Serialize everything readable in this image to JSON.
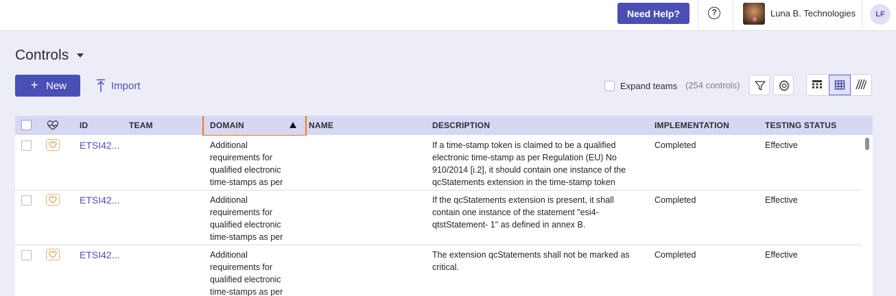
{
  "topbar": {
    "help_label": "Need Help?",
    "help_icon": "question-circle-icon",
    "org_name": "Luna B. Technologies",
    "user_initials": "LF"
  },
  "page": {
    "title": "Controls"
  },
  "actions": {
    "new_label": "New",
    "import_label": "Import",
    "expand_teams_label": "Expand teams",
    "expand_teams_checked": false,
    "count_label": "(254 controls)"
  },
  "table": {
    "headers": {
      "id": "ID",
      "team": "TEAM",
      "domain": "DOMAIN",
      "name": "NAME",
      "description": "DESCRIPTION",
      "implementation": "IMPLEMENTATION",
      "testing_status": "TESTING STATUS"
    },
    "sort": {
      "column": "DOMAIN",
      "direction": "ascending"
    },
    "rows": [
      {
        "id": "ETSI42...",
        "team": "",
        "domain": "Additional requirements for qualified electronic time-stamps as per",
        "name": "",
        "description": "If a time-stamp token is claimed to be a qualified electronic time-stamp as per Regulation (EU) No 910/2014 [i.2], it should contain one instance of the qcStatements extension in the time-stamp token",
        "implementation": "Completed",
        "testing_status": "Effective"
      },
      {
        "id": "ETSI42...",
        "team": "",
        "domain": "Additional requirements for qualified electronic time-stamps as per",
        "name": "",
        "description": "If the qcStatements extension is present, it shall contain one instance of the statement \"esi4-qtstStatement- 1\" as defined in annex B.",
        "implementation": "Completed",
        "testing_status": "Effective"
      },
      {
        "id": "ETSI42...",
        "team": "",
        "domain": "Additional requirements for qualified electronic time-stamps as per",
        "name": "",
        "description": "The extension qcStatements shall not be marked as critical.",
        "implementation": "Completed",
        "testing_status": "Effective"
      }
    ]
  },
  "colors": {
    "accent": "#4a4fb5",
    "header_bg": "#d6d8f3",
    "highlight": "#f07a16",
    "health_icon": "#e8a05a"
  }
}
